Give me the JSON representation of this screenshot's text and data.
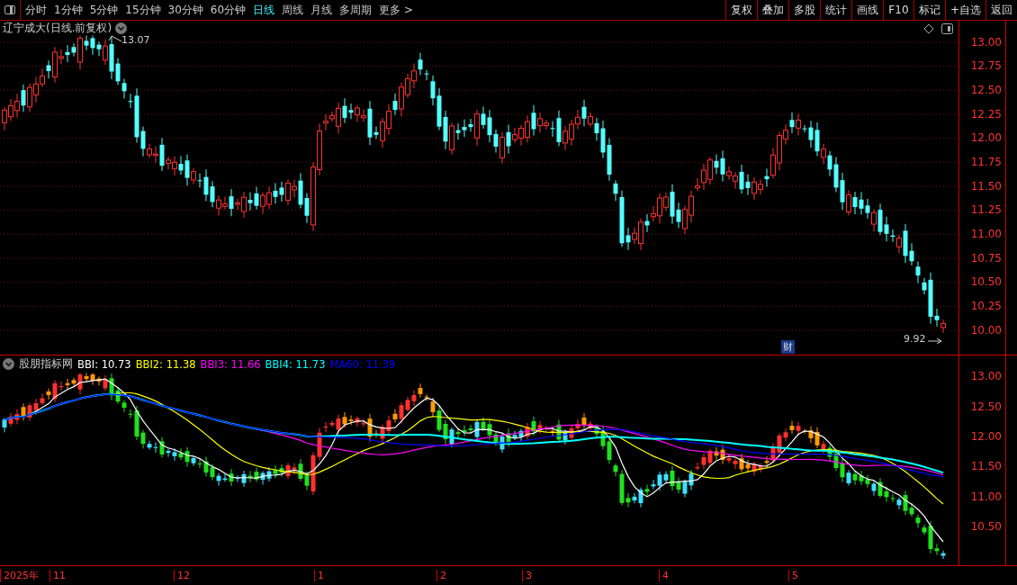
{
  "toolbar": {
    "periods": [
      {
        "label": "分时",
        "selected": false
      },
      {
        "label": "1分钟",
        "selected": false
      },
      {
        "label": "5分钟",
        "selected": false
      },
      {
        "label": "15分钟",
        "selected": false
      },
      {
        "label": "30分钟",
        "selected": false
      },
      {
        "label": "60分钟",
        "selected": false
      },
      {
        "label": "日线",
        "selected": true
      },
      {
        "label": "周线",
        "selected": false
      },
      {
        "label": "月线",
        "selected": false
      },
      {
        "label": "多周期",
        "selected": false
      },
      {
        "label": "更多 >",
        "selected": false
      }
    ],
    "buttons": [
      "复权",
      "叠加",
      "多股",
      "统计",
      "画线",
      "F10",
      "标记",
      "+自选",
      "返回"
    ]
  },
  "price_chart": {
    "title": "辽宁成大(日线.前复权)",
    "high_label": "13.07",
    "low_label": "9.92",
    "event_badge": "财",
    "y_ticks": [
      "13.00",
      "12.75",
      "12.50",
      "12.25",
      "12.00",
      "11.75",
      "11.50",
      "11.25",
      "11.00",
      "10.75",
      "10.50",
      "10.25",
      "10.00"
    ]
  },
  "indicator": {
    "name": "股朋指标网",
    "lines": [
      {
        "label": "BBI: 10.73",
        "color": "#ffffff"
      },
      {
        "label": "BBI2: 11.38",
        "color": "#ffff00"
      },
      {
        "label": "BBI3: 11.66",
        "color": "#ff00ff"
      },
      {
        "label": "BBI4: 11.73",
        "color": "#00ffff"
      },
      {
        "label": "MA60: 11.39",
        "color": "#0000ff"
      }
    ],
    "y_ticks": [
      "13.00",
      "12.50",
      "12.00",
      "11.50",
      "11.00",
      "10.50"
    ]
  },
  "date_axis": [
    "2025年",
    "11",
    "12",
    "1",
    "2",
    "3",
    "4",
    "5"
  ]
}
